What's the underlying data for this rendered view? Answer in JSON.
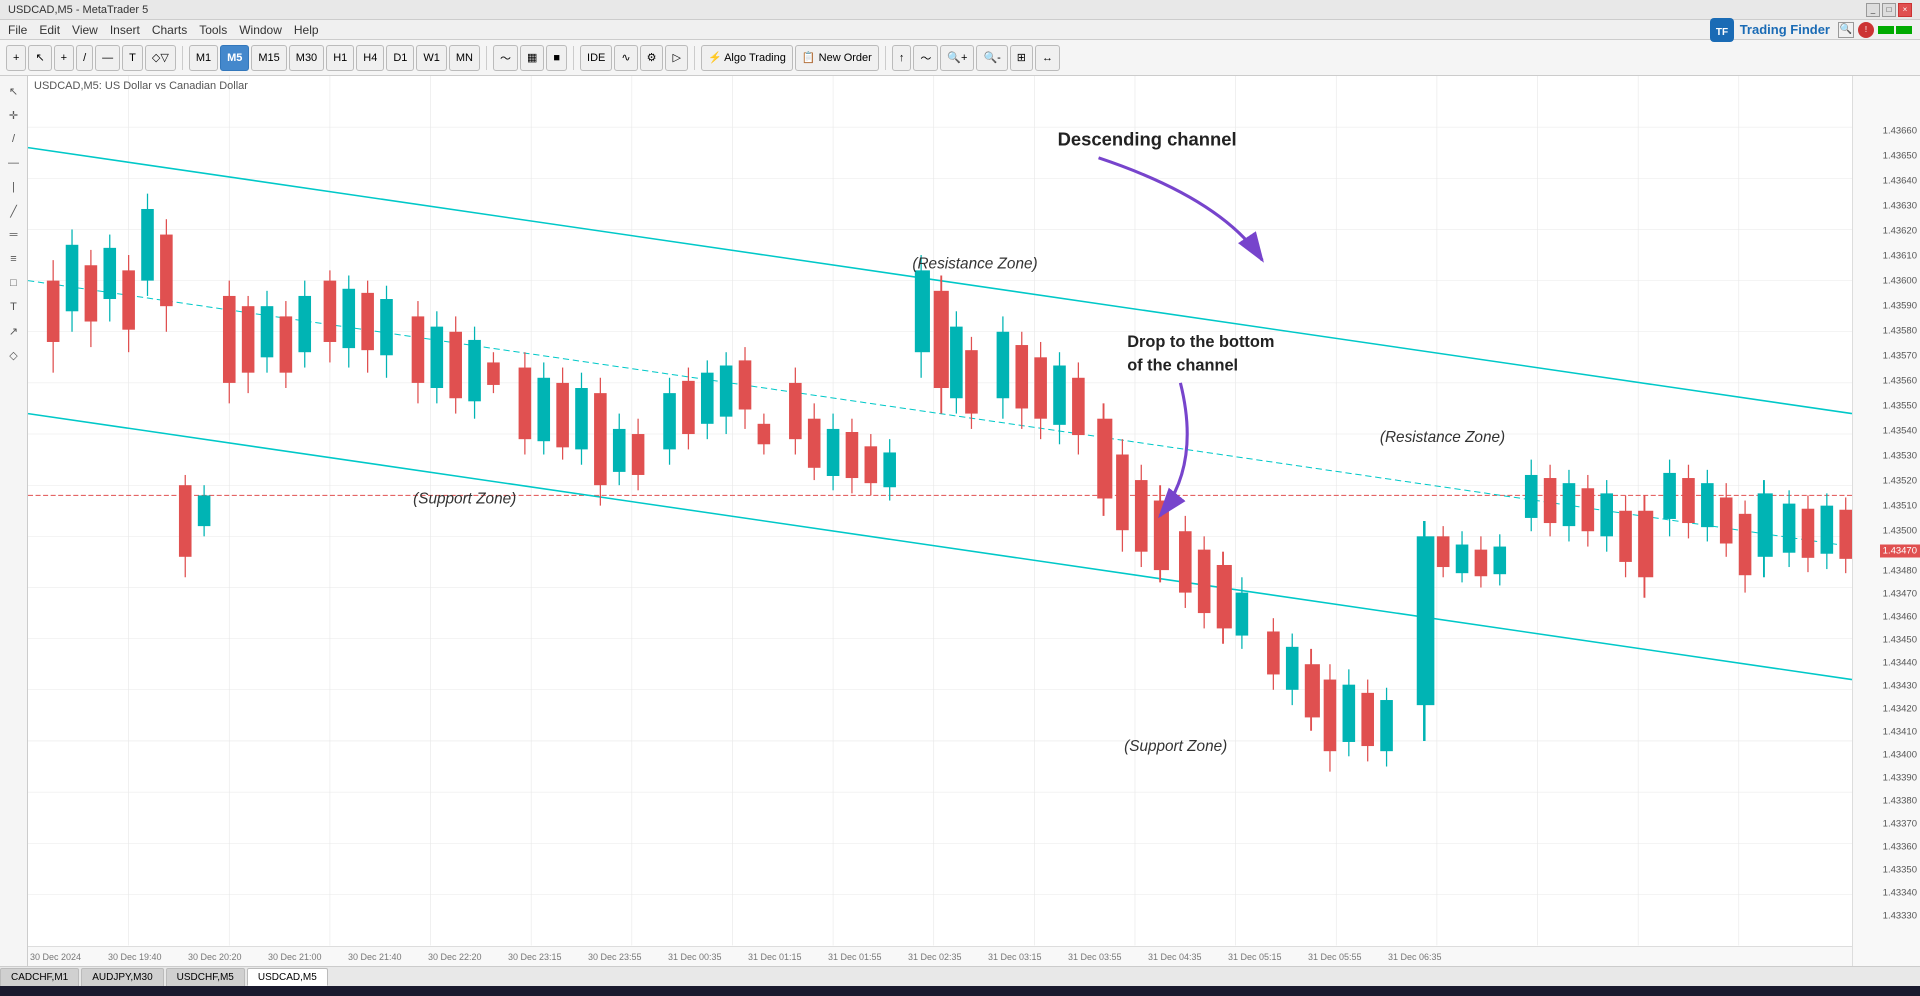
{
  "window": {
    "title": "USDCAD,M5 - MetaTrader 5",
    "controls": [
      "_",
      "□",
      "×"
    ]
  },
  "menubar": {
    "items": [
      "File",
      "Edit",
      "View",
      "Insert",
      "Charts",
      "Tools",
      "Window",
      "Help"
    ]
  },
  "toolbar": {
    "timeframes": [
      "M1",
      "M5",
      "M15",
      "M30",
      "H1",
      "H4",
      "D1",
      "W1",
      "MN"
    ],
    "active_tf": "M5",
    "buttons": [
      "IDE",
      "Algo Trading",
      "New Order"
    ],
    "chart_types": [
      "line",
      "bar",
      "candle"
    ],
    "zoom_in": "+",
    "zoom_out": "-"
  },
  "symbol_info": "USDCAD,M5: US Dollar vs Canadian Dollar",
  "chart": {
    "annotations": {
      "descending_channel": "Descending channel",
      "resistance_zone_top": "(Resistance Zone)",
      "resistance_zone_right": "(Resistance Zone)",
      "support_zone_bottom_left": "(Support Zone)",
      "support_zone_bottom": "(Support Zone)",
      "drop_text_line1": "Drop to the bottom",
      "drop_text_line2": "of the channel"
    },
    "price_levels": [
      "1.43660",
      "1.43650",
      "1.43640",
      "1.43630",
      "1.43620",
      "1.43610",
      "1.43600",
      "1.43590",
      "1.43580",
      "1.43570",
      "1.43560",
      "1.43550",
      "1.43540",
      "1.43530",
      "1.43520",
      "1.43510",
      "1.43500",
      "1.43490",
      "1.43480",
      "1.43470",
      "1.43460",
      "1.43450",
      "1.43440",
      "1.43430",
      "1.43420",
      "1.43410",
      "1.43400",
      "1.43390",
      "1.43380",
      "1.43370",
      "1.43360",
      "1.43350",
      "1.43340",
      "1.43330"
    ],
    "current_price": "1.43470",
    "time_labels": [
      "30 Dec 2024",
      "30 Dec 19:40",
      "30 Dec 20:20",
      "30 Dec 21:00",
      "30 Dec 21:40",
      "30 Dec 22:20",
      "30 Dec 23:15",
      "30 Dec 23:55",
      "31 Dec 00:35",
      "31 Dec 01:15",
      "31 Dec 01:55",
      "31 Dec 02:35",
      "31 Dec 03:15",
      "31 Dec 03:55",
      "31 Dec 04:35",
      "31 Dec 05:15",
      "31 Dec 05:55",
      "31 Dec 06:35"
    ]
  },
  "logo": {
    "text": "Trading Finder",
    "icon": "TF"
  },
  "tabs": [
    {
      "label": "CADCHF,M1",
      "active": false
    },
    {
      "label": "AUDJPY,M30",
      "active": false
    },
    {
      "label": "USDCHF,M5",
      "active": false
    },
    {
      "label": "USDCAD,M5",
      "active": true
    }
  ],
  "colors": {
    "bull_candle": "#00b4b4",
    "bear_candle": "#e05050",
    "channel_line": "#5dd5d5",
    "arrow_color": "#7744cc",
    "bg": "#ffffff",
    "grid": "#f0f0f0"
  }
}
